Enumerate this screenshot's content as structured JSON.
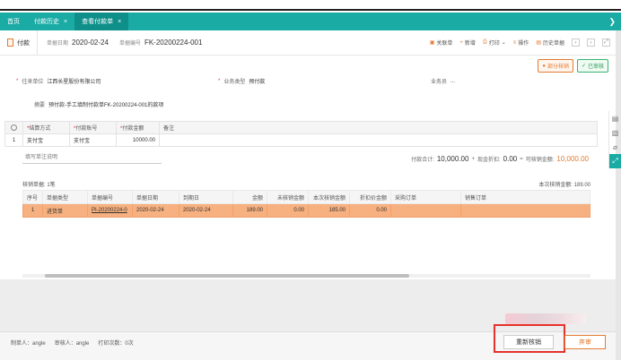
{
  "tabs": [
    {
      "label": "首页"
    },
    {
      "label": "付款历史",
      "close": "×"
    },
    {
      "label": "查看付款单",
      "close": "×"
    }
  ],
  "tabbar_more": "❯",
  "toolbar": {
    "doc_label": "付款",
    "date_label": "单据日期",
    "date_value": "2020-02-24",
    "number_label": "单据编号",
    "number_value": "FK-20200224-001",
    "actions": [
      "关联单",
      "新增",
      "打印",
      "操作",
      "历史单据"
    ]
  },
  "status": {
    "partial": "部分核销",
    "audited": "已审核"
  },
  "form": {
    "vendor_label": "往来单位",
    "vendor_value": "江西长星股份有限公司",
    "biztype_label": "业务类型",
    "biztype_value": "预付款",
    "salesman_label": "业务员",
    "salesman_value": "...",
    "memo_label": "摘要",
    "memo_value": "预付款-手工填制付款单FK-20200224-001的款项"
  },
  "grid": {
    "headers": [
      "结算方式",
      "付款账号",
      "付款金额",
      "备注"
    ],
    "rows": [
      {
        "no": "1",
        "method": "支付宝",
        "account": "支付宝",
        "amount": "10000.00",
        "note": ""
      }
    ]
  },
  "note_placeholder": "填写单注说明",
  "totals": {
    "pay_label": "付款合计:",
    "pay_value": "10,000.00",
    "discount_label": "现金折扣:",
    "discount_value": "0.00",
    "writeoff_label": "可核销金额:",
    "writeoff_value": "10,000.00"
  },
  "sidebar_icons": [
    "document-icon",
    "image-icon",
    "attachment-icon",
    "expand-icon"
  ],
  "writeoff": {
    "title": "核销单据: 1笔",
    "summary": "本次核销金额: 189.00",
    "headers": [
      "序号",
      "单据类型",
      "单据编号",
      "单据日期",
      "到期日",
      "金额",
      "未核销金额",
      "本次核销金额",
      "折扣价金额",
      "采购订单",
      "销售订单"
    ],
    "rows": [
      {
        "no": "1",
        "type": "进货单",
        "number": "PI-20200224-0",
        "date": "2020-02-24",
        "due": "2020-02-24",
        "amount": "189.00",
        "unpaid": "0.00",
        "this": "185.00",
        "discount": "0.00",
        "po": "",
        "so": ""
      }
    ]
  },
  "footer": {
    "creator": "制单人：angle",
    "auditor": "审核人：angle",
    "prints": "打印次数：0次",
    "redo_button": "重新核销",
    "reaudit_button": "弃审"
  }
}
